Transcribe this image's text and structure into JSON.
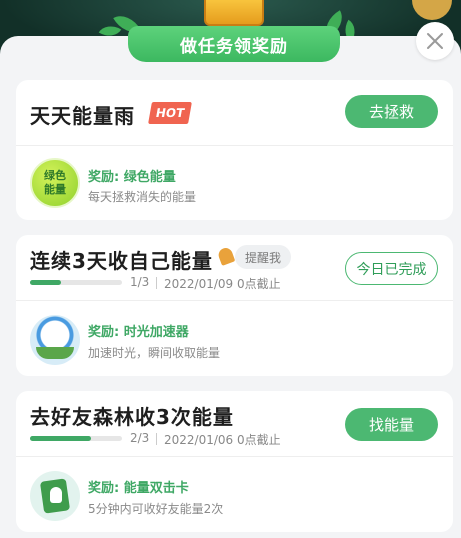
{
  "header": {
    "title": "做任务领奖励"
  },
  "tasks": [
    {
      "title": "天天能量雨",
      "hot": "HOT",
      "action": "去拯救",
      "reward_label": "奖励: 绿色能量",
      "reward_desc": "每天拯救消失的能量",
      "reward_icon_text": "绿色能量"
    },
    {
      "title": "连续3天收自己能量",
      "remind": "提醒我",
      "action": "今日已完成",
      "progress_text": "1/3",
      "progress_value": 0.333,
      "deadline": "2022/01/09 0点截止",
      "reward_label": "奖励: 时光加速器",
      "reward_desc": "加速时光，瞬间收取能量"
    },
    {
      "title": "去好友森林收3次能量",
      "action": "找能量",
      "progress_text": "2/3",
      "progress_value": 0.667,
      "deadline": "2022/01/06 0点截止",
      "reward_label": "奖励: 能量双击卡",
      "reward_desc": "5分钟内可收好友能量2次"
    }
  ],
  "colors": {
    "accent": "#4cb872",
    "hot": "#f06450",
    "reward_text": "#3fa865"
  }
}
